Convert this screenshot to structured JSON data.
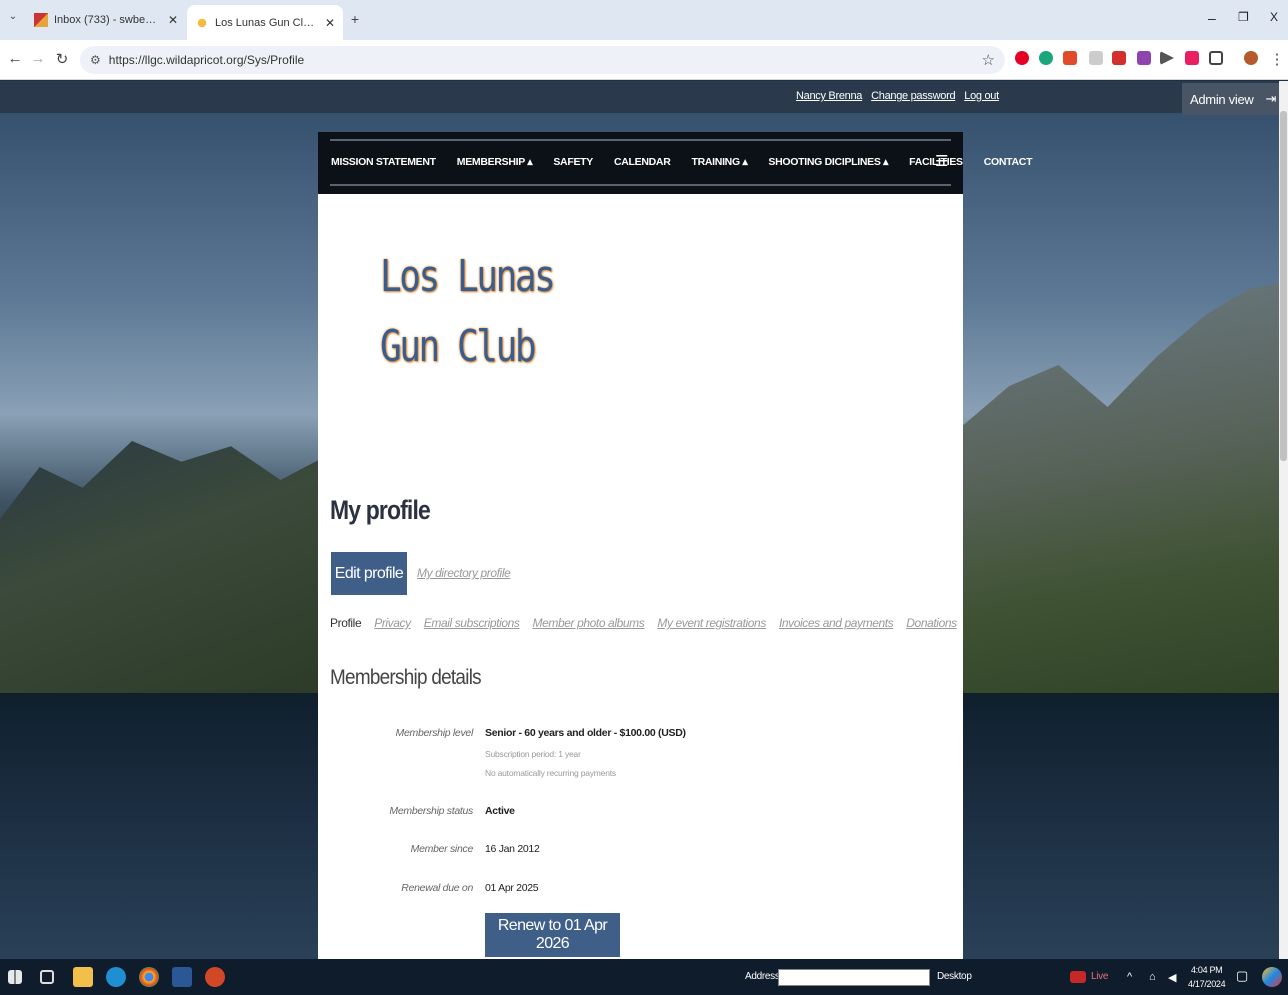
{
  "browser": {
    "tabs": [
      {
        "title": "Inbox (733) - swbear737@gma",
        "active": false
      },
      {
        "title": "Los Lunas Gun Club - My profil",
        "active": true
      }
    ],
    "new_tab": "+",
    "url": "https://llgc.wildapricot.org/Sys/Profile",
    "window_controls": {
      "minimize": "–",
      "restore": "❐",
      "close": "X"
    }
  },
  "site": {
    "user_links": {
      "name": "Nancy Brenna",
      "change_password": "Change password",
      "logout": "Log out"
    },
    "admin_view": "Admin view",
    "nav": [
      "MISSION STATEMENT",
      "MEMBERSHIP ▴",
      "SAFETY",
      "CALENDAR",
      "TRAINING ▴",
      "SHOOTING DICIPLINES ▴",
      "FACILITIES",
      "CONTACT"
    ],
    "logo_line1": "Los Lunas",
    "logo_line2": "Gun Club"
  },
  "profile": {
    "title": "My profile",
    "edit_button": "Edit profile",
    "directory_link": "My directory profile",
    "tabs": [
      "Profile",
      "Privacy",
      "Email subscriptions",
      "Member photo albums",
      "My event registrations",
      "Invoices and payments",
      "Donations"
    ],
    "section_title": "Membership details",
    "fields": {
      "level_label": "Membership level",
      "level_value": "Senior - 60 years and older - $100.00 (USD)",
      "level_note1": "Subscription period: 1 year",
      "level_note2": "No automatically recurring payments",
      "status_label": "Membership status",
      "status_value": "Active",
      "since_label": "Member since",
      "since_value": "16 Jan 2012",
      "renewal_label": "Renewal due on",
      "renewal_value": "01 Apr 2025"
    },
    "renew_button": "Renew to 01 Apr 2026"
  },
  "taskbar": {
    "address_label": "Address",
    "desktop_label": "Desktop",
    "live_label": "Live",
    "time": "4:04 PM",
    "date": "4/17/2024"
  },
  "colors": {
    "button_blue": "#3f5f89",
    "nav_black": "#0b1116",
    "logo_blue": "#3a5d8f",
    "logo_glow": "#e89b3c"
  }
}
